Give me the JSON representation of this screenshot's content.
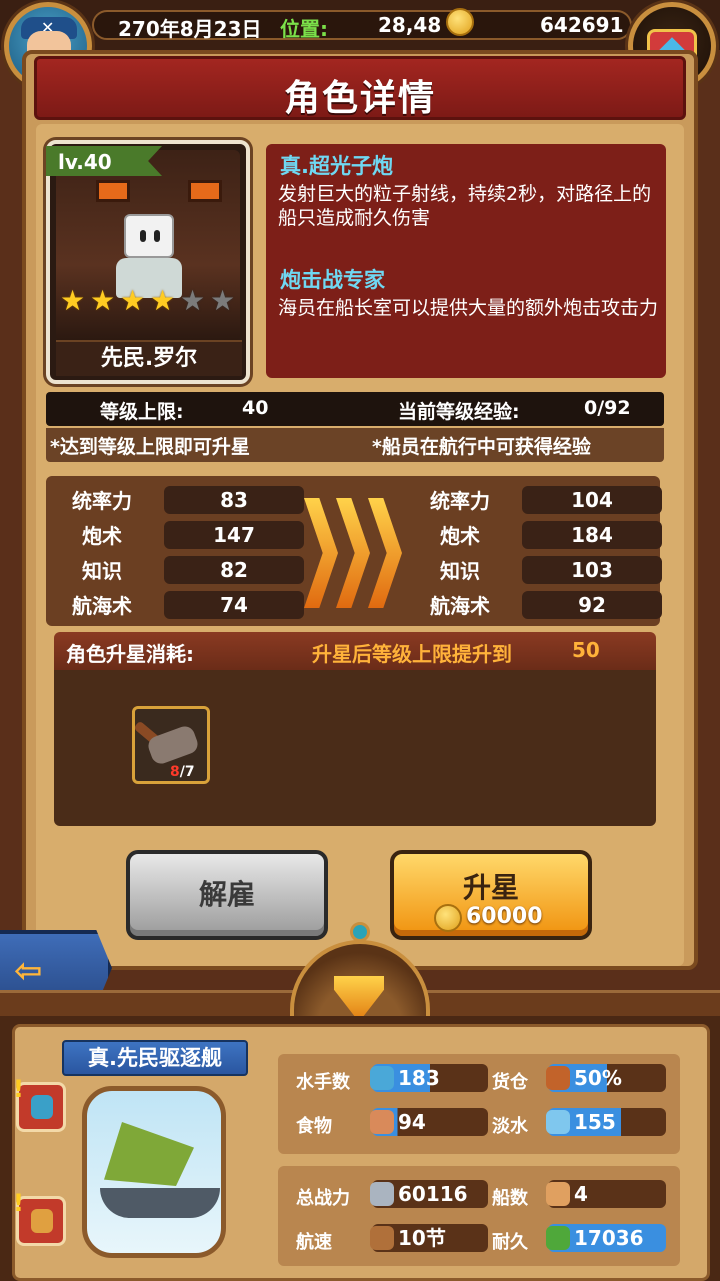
{
  "topbar": {
    "date": "270年8月23日",
    "position_label": "位置:",
    "position_value": "28,48",
    "gold": "642691"
  },
  "title": "角色详情",
  "character": {
    "level_tag": "lv.40",
    "name": "先民.罗尔",
    "stars_filled": 4,
    "stars_total": 6
  },
  "skills": [
    {
      "name": "真.超光子炮",
      "description": "发射巨大的粒子射线，持续2秒，对路径上的船只造成耐久伤害"
    },
    {
      "name": "炮击战专家",
      "description": "海员在船长室可以提供大量的额外炮击攻击力"
    }
  ],
  "level_info": {
    "cap_label": "等级上限:",
    "cap_value": "40",
    "exp_label": "当前等级经验:",
    "exp_value": "0/92",
    "hint_left": "*达到等级上限即可升星",
    "hint_right": "*船员在航行中可获得经验"
  },
  "stats_current": [
    {
      "label": "统率力",
      "value": "83"
    },
    {
      "label": "炮术",
      "value": "147"
    },
    {
      "label": "知识",
      "value": "82"
    },
    {
      "label": "航海术",
      "value": "74"
    }
  ],
  "stats_next": [
    {
      "label": "统率力",
      "value": "104"
    },
    {
      "label": "炮术",
      "value": "184"
    },
    {
      "label": "知识",
      "value": "103"
    },
    {
      "label": "航海术",
      "value": "92"
    }
  ],
  "upgrade": {
    "cost_label": "角色升星消耗:",
    "cap_after_label": "升星后等级上限提升到",
    "cap_after_value": "50",
    "item_have": "8",
    "item_need": "/7"
  },
  "buttons": {
    "dismiss": "解雇",
    "star_up": "升星",
    "star_up_cost": "60000"
  },
  "ship": {
    "name": "真.先民驱逐舰",
    "sailors_label": "水手数",
    "sailors": "183",
    "cargo_label": "货仓",
    "cargo": "50%",
    "food_label": "食物",
    "food": "94",
    "water_label": "淡水",
    "water": "155",
    "power_label": "总战力",
    "power": "60116",
    "ships_label": "船数",
    "ships": "4",
    "speed_label": "航速",
    "speed": "10节",
    "durability_label": "耐久",
    "durability": "17036"
  },
  "colors": {
    "skill_title": "#6fd8f2",
    "position_label": "#7be04a",
    "title_bar": "#a32620",
    "star_on": "#ffcc22"
  }
}
